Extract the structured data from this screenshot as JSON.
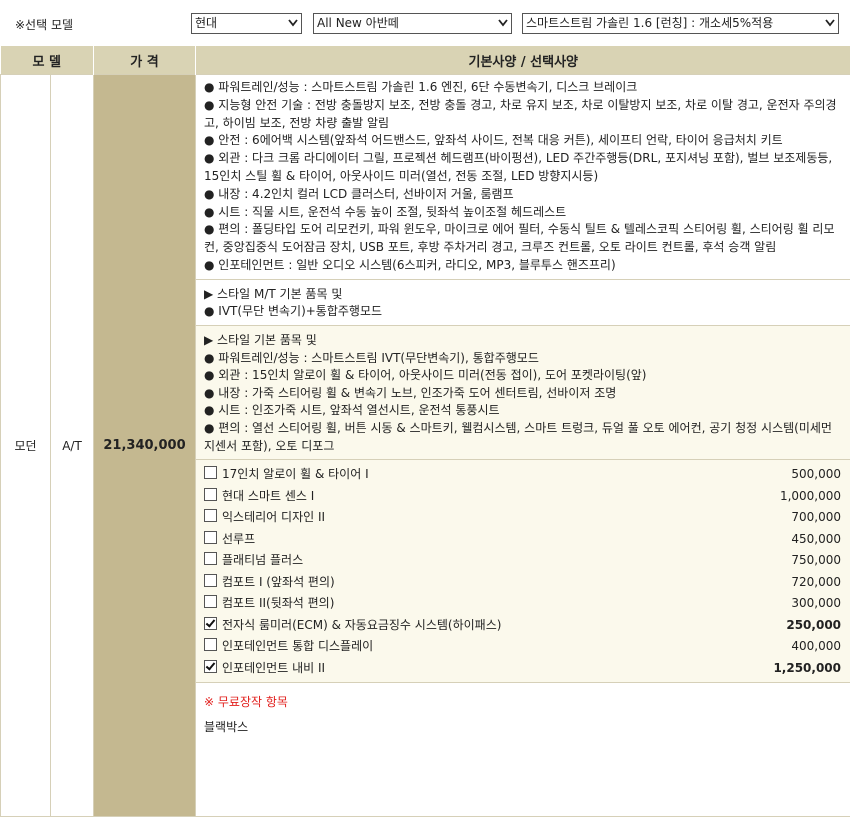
{
  "header": {
    "label": "※선택 모델",
    "brand": "현대",
    "model": "All New 아반떼",
    "trim": "스마트스트림 가솔린 1.6 [런칭] : 개소세5%적용"
  },
  "table": {
    "headers": [
      "모 델",
      "가 격",
      "기본사양 / 선택사양"
    ],
    "model_name": "모던",
    "transmission": "A/T",
    "price": "21,340,000",
    "basic_spec": [
      "● 파워트레인/성능 : 스마트스트림 가솔린 1.6 엔진, 6단 수동변속기, 디스크 브레이크",
      "● 지능형 안전 기술 : 전방 충돌방지 보조, 전방 충돌 경고, 차로 유지 보조, 차로 이탈방지 보조, 차로 이탈 경고, 운전자 주의경고, 하이빔 보조, 전방 차량 출발 알림",
      "● 안전 : 6에어백 시스템(앞좌석 어드밴스드, 앞좌석 사이드, 전복 대응 커튼), 세이프티 언락, 타이어 응급처치 키트",
      "● 외관 : 다크 크롬 라디에이터 그릴, 프로젝션 헤드램프(바이펑션), LED 주간주행등(DRL, 포지셔닝 포함), 벌브 보조제동등, 15인치 스틸 휠 & 타이어, 아웃사이드 미러(열선, 전동 조절, LED 방향지시등)",
      "● 내장 : 4.2인치 컬러 LCD 클러스터, 선바이저 거울, 룸램프",
      "● 시트 : 직물 시트, 운전석 수동 높이 조절, 뒷좌석 높이조절 헤드레스트",
      "● 편의 : 폴딩타입 도어 리모컨키, 파워 윈도우, 마이크로 에어 필터, 수동식 틸트 & 텔레스코픽 스티어링 휠, 스티어링 휠 리모컨, 중앙집중식 도어잠금 장치, USB 포트, 후방 주차거리 경고, 크루즈 컨트롤, 오토 라이트 컨트롤, 후석 승객 알림",
      "● 인포테인먼트 : 일반 오디오 시스템(6스피커, 라디오, MP3, 블루투스 핸즈프리)"
    ],
    "mt_spec": [
      "▶ 스타일 M/T 기본 품목 및",
      "● IVT(무단 변속기)+통합주행모드"
    ],
    "style_spec": [
      "▶ 스타일 기본 품목 및",
      "● 파워트레인/성능 : 스마트스트림 IVT(무단변속기), 통합주행모드",
      "● 외관 : 15인치 알로이 휠 & 타이어, 아웃사이드 미러(전동 접이), 도어 포켓라이팅(앞)",
      "● 내장 : 가죽 스티어링 휠 & 변속기 노브, 인조가죽 도어 센터트림, 선바이저 조명",
      "● 시트 : 인조가죽 시트, 앞좌석 열선시트, 운전석 통풍시트",
      "● 편의 : 열선 스티어링 휠, 버튼 시동 & 스마트키, 웰컴시스템, 스마트 트렁크, 듀얼 풀 오토 에어컨, 공기 청정 시스템(미세먼지센서 포함), 오토 디포그"
    ],
    "options": [
      {
        "label": "17인치 알로이 휠 & 타이어 I",
        "price": "500,000",
        "checked": false
      },
      {
        "label": "현대 스마트 센스 I",
        "price": "1,000,000",
        "checked": false
      },
      {
        "label": "익스테리어 디자인 II",
        "price": "700,000",
        "checked": false
      },
      {
        "label": "선루프",
        "price": "450,000",
        "checked": false
      },
      {
        "label": "플래티넘 플러스",
        "price": "750,000",
        "checked": false
      },
      {
        "label": "컴포트 I (앞좌석 편의)",
        "price": "720,000",
        "checked": false
      },
      {
        "label": "컴포트 II(뒷좌석 편의)",
        "price": "300,000",
        "checked": false
      },
      {
        "label": "전자식 룸미러(ECM) & 자동요금징수 시스템(하이패스)",
        "price": "250,000",
        "checked": true
      },
      {
        "label": "인포테인먼트 통합 디스플레이",
        "price": "400,000",
        "checked": false
      },
      {
        "label": "인포테인먼트 내비 II",
        "price": "1,250,000",
        "checked": true
      }
    ],
    "free_title": "※ 무료장작 항목",
    "free_items": [
      "블랙박스"
    ]
  }
}
